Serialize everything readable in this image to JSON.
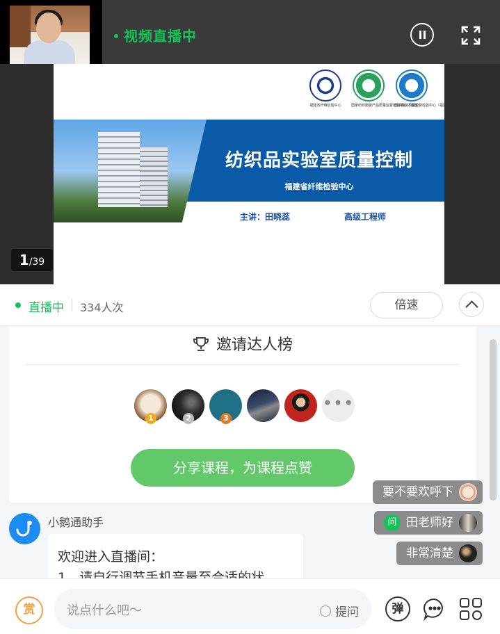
{
  "player": {
    "status_label": "视频直播中"
  },
  "slide": {
    "title": "纺织品实验室质量控制",
    "subtitle": "福建省纤维检验中心",
    "presenter": "主讲：田晓蕊",
    "presenter_title": "高级工程师",
    "logos": [
      {
        "caption": "福建省纤维检验中心",
        "color": "#1d3f8a"
      },
      {
        "caption": "国家纺织服装产品质量监督检验中心（福建）",
        "color": "#2aa05a"
      },
      {
        "caption": "国家服装质量监督检验中心（福建）",
        "color": "#1f7bc7"
      }
    ],
    "page_current": "1",
    "page_total": "/39"
  },
  "info": {
    "live_label": "直播中",
    "viewers": "334人次",
    "speed_label": "倍速"
  },
  "invite": {
    "title": "邀请达人榜",
    "avatars": [
      {
        "rank": "1",
        "medal_color": "#f0a81c",
        "face": "#e8d9c6"
      },
      {
        "rank": "2",
        "medal_color": "#b9b9b9",
        "face": "#2b2b2b"
      },
      {
        "rank": "3",
        "medal_color": "#e07b22",
        "face": "#1f6f86"
      },
      {
        "rank": "",
        "medal_color": "",
        "face": "#3a4a6a"
      },
      {
        "rank": "",
        "medal_color": "",
        "face": "#c1231f"
      }
    ],
    "more_label": "•••",
    "share_label": "分享课程，为课程点赞"
  },
  "bot": {
    "name": "小鹅通助手",
    "line1": "欢迎进入直播间：",
    "line2": "1、请自行调节手机音量至合适的状"
  },
  "danmaku": [
    {
      "text": "要不要欢呼下",
      "avatar_color": "#f3e3d3"
    },
    {
      "text": "田老师好",
      "badge": "问",
      "avatar_color": "#d9d4cf"
    },
    {
      "text": "非常清楚",
      "avatar_color": "#222222"
    }
  ],
  "composer": {
    "reward_label": "赏",
    "placeholder": "说点什么吧～",
    "ask_label": "提问",
    "danmaku_label": "弹"
  },
  "colors": {
    "accent_green": "#15c25a",
    "share_green": "#62c96a",
    "slide_blue": "#0a5aa8",
    "reward_orange": "#f2a144"
  }
}
